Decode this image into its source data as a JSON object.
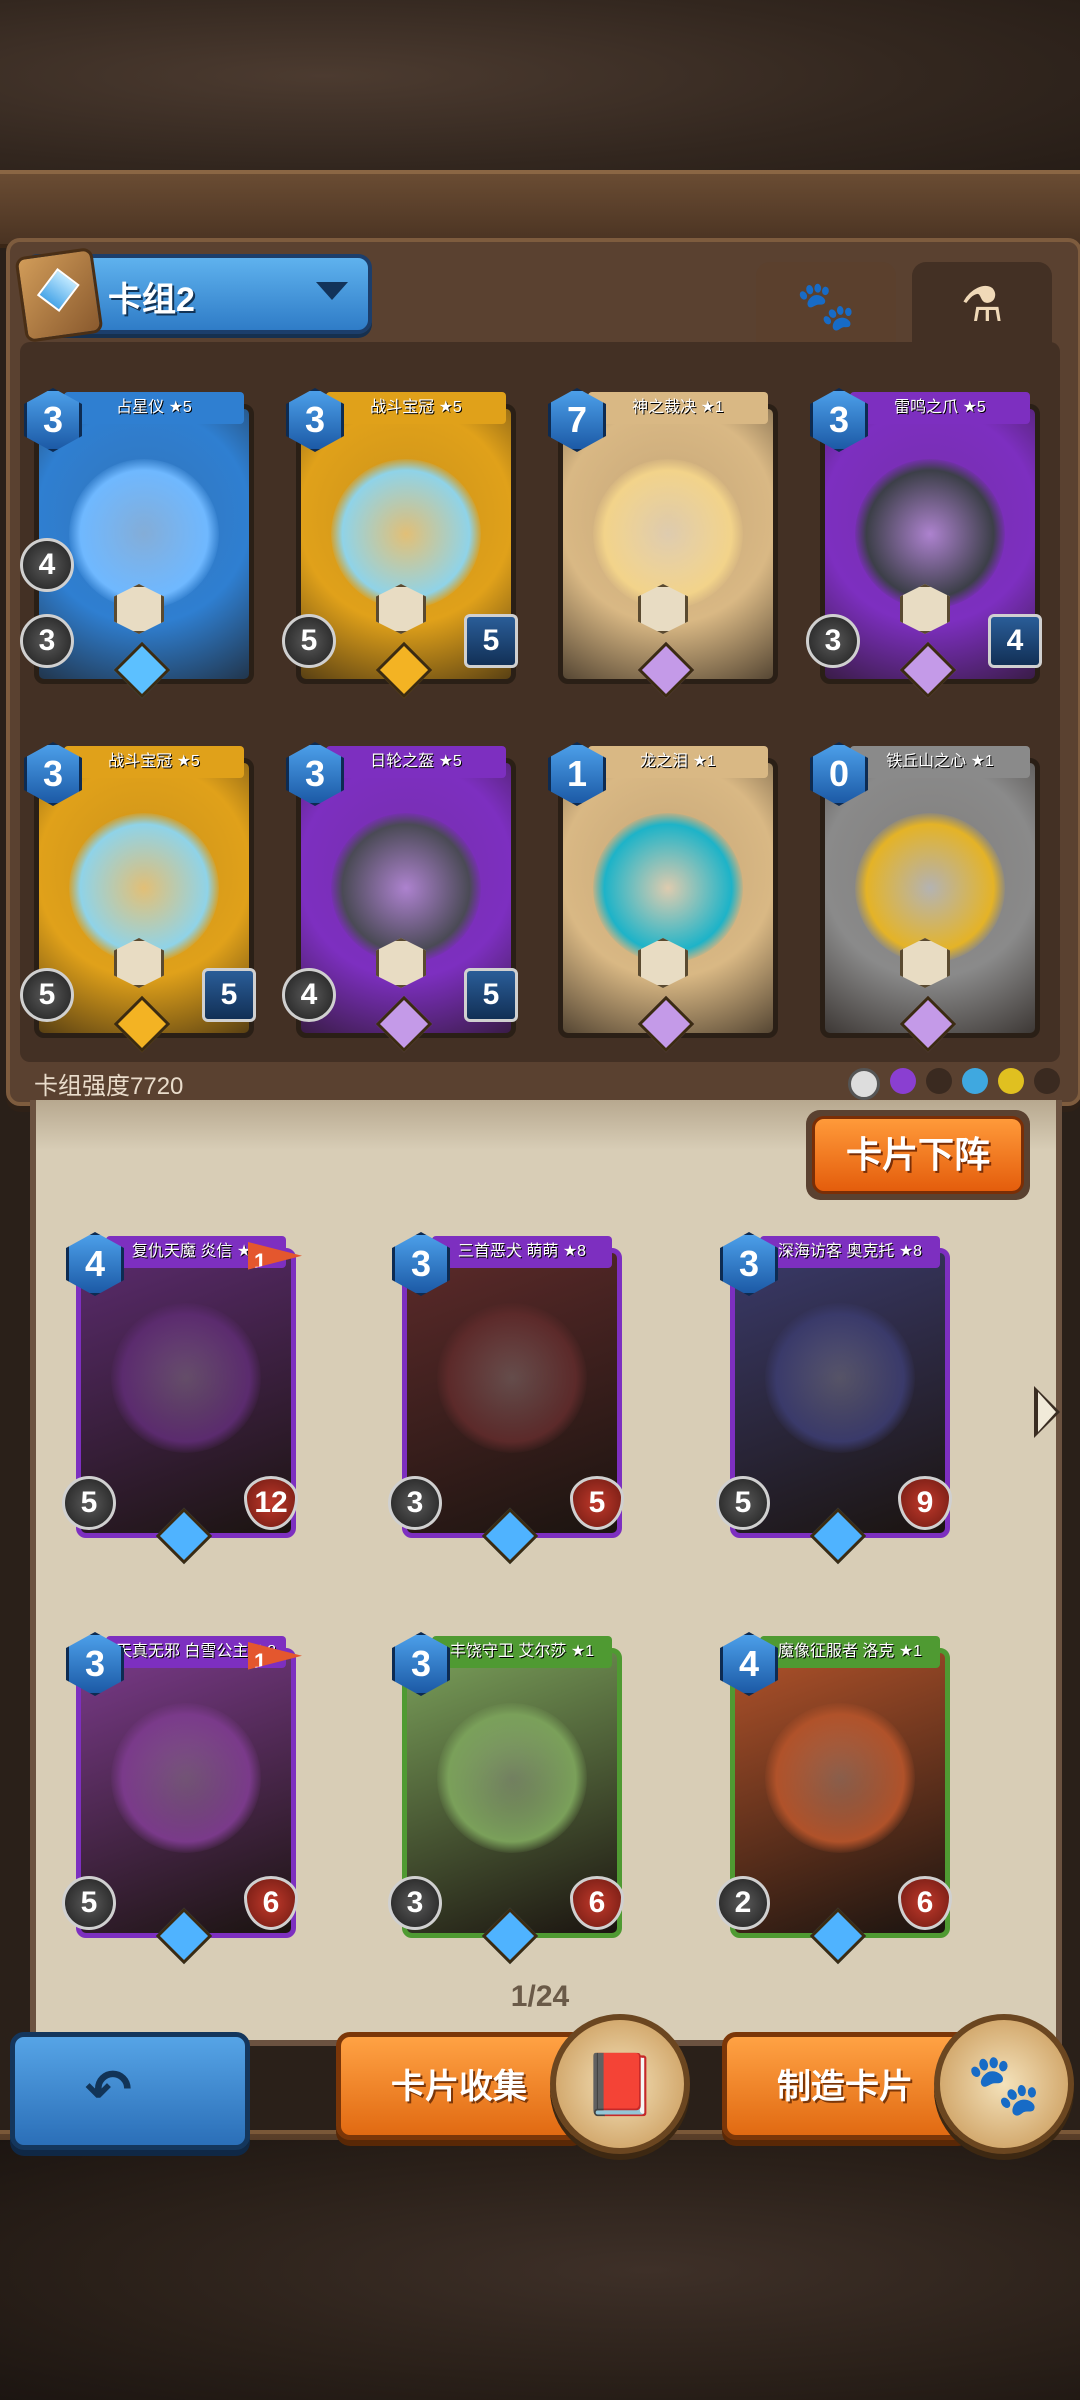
{
  "deck": {
    "name": "卡组2",
    "strength_label": "卡组强度7720",
    "tabs": {
      "paw": "🐾",
      "potion": "⚗"
    },
    "cards": [
      {
        "name": "占星仪 ★5",
        "cost": "3",
        "stat_a": "4",
        "stat_b": "3",
        "stat_c": "",
        "theme": "blue",
        "art": "#6fb8ff",
        "gem": "#5cc0ff"
      },
      {
        "name": "战斗宝冠 ★5",
        "cost": "3",
        "stat_a": "",
        "stat_b": "5",
        "stat_c": "5",
        "theme": "gold",
        "art": "#8fd3e8",
        "gem": "#f3b323"
      },
      {
        "name": "神之裁决 ★1",
        "cost": "7",
        "stat_a": "",
        "stat_b": "",
        "stat_c": "",
        "theme": "tan",
        "art": "#f2d38a",
        "gem": "#c49ae8"
      },
      {
        "name": "雷鸣之爪 ★5",
        "cost": "3",
        "stat_a": "",
        "stat_b": "3",
        "stat_c": "4",
        "theme": "purple",
        "art": "#3c3f48",
        "gem": "#c49ae8"
      },
      {
        "name": "战斗宝冠 ★5",
        "cost": "3",
        "stat_a": "",
        "stat_b": "5",
        "stat_c": "5",
        "theme": "gold",
        "art": "#8fd3e8",
        "gem": "#f3b323"
      },
      {
        "name": "日轮之盔 ★5",
        "cost": "3",
        "stat_a": "",
        "stat_b": "4",
        "stat_c": "5",
        "theme": "purple",
        "art": "#4a4a55",
        "gem": "#c49ae8"
      },
      {
        "name": "龙之泪 ★1",
        "cost": "1",
        "stat_a": "",
        "stat_b": "",
        "stat_c": "",
        "theme": "tan",
        "art": "#1db3c8",
        "gem": "#c49ae8"
      },
      {
        "name": "铁丘山之心 ★1",
        "cost": "0",
        "stat_a": "",
        "stat_b": "",
        "stat_c": "",
        "theme": "gray",
        "art": "#e4b327",
        "gem": "#c49ae8"
      }
    ]
  },
  "undeploy_label": "卡片下阵",
  "collection": {
    "cards": [
      {
        "name": "复仇天魔 炎信 ★8",
        "cost": "4",
        "flag": "1",
        "stat_b": "5",
        "stat_c": "12",
        "theme": "purple",
        "art": "#5b2b6e"
      },
      {
        "name": "三首恶犬 萌萌 ★8",
        "cost": "3",
        "flag": "",
        "stat_b": "3",
        "stat_c": "5",
        "theme": "purple",
        "art": "#5c2a2a"
      },
      {
        "name": "深海访客 奥克托 ★8",
        "cost": "3",
        "flag": "",
        "stat_b": "5",
        "stat_c": "9",
        "theme": "purple",
        "art": "#3a3a6a"
      },
      {
        "name": "天真无邪 白雪公主 ★8",
        "cost": "3",
        "flag": "1",
        "stat_b": "5",
        "stat_c": "6",
        "theme": "purple",
        "art": "#7a3a8a"
      },
      {
        "name": "丰饶守卫 艾尔莎 ★1",
        "cost": "3",
        "flag": "",
        "stat_b": "3",
        "stat_c": "6",
        "theme": "green",
        "art": "#7aa05a"
      },
      {
        "name": "魔像征服者 洛克 ★1",
        "cost": "4",
        "flag": "",
        "stat_b": "2",
        "stat_c": "6",
        "theme": "green",
        "art": "#b0522a"
      }
    ],
    "page": "1/24"
  },
  "bottom": {
    "back_icon": "back-arrow-icon",
    "collection_label": "卡片收集",
    "craft_label": "制造卡片"
  },
  "colors": {
    "blue": "#2f7fd1",
    "gold": "#e0a11a",
    "tan": "#d9b884",
    "purple": "#7d2fc0",
    "gray": "#8a8a8a",
    "green": "#4f9a32"
  }
}
